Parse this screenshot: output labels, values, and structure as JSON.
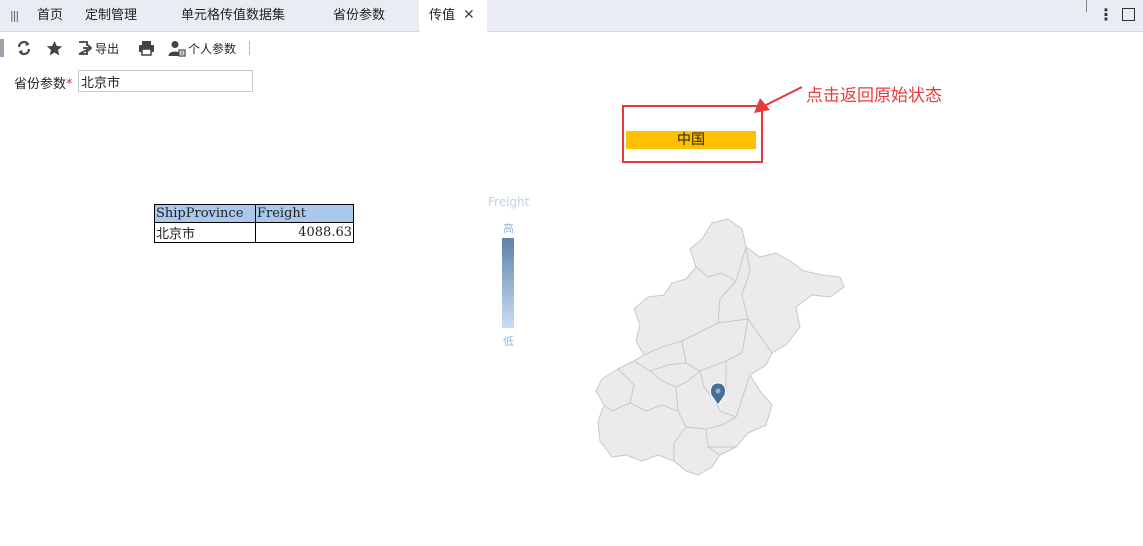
{
  "tabs": [
    {
      "label": "首页"
    },
    {
      "label": "定制管理"
    },
    {
      "label": "单元格传值数据集"
    },
    {
      "label": "省份参数"
    },
    {
      "label": "传值",
      "active": true
    }
  ],
  "toolbar": {
    "export_label": "导出",
    "personal_params_label": "个人参数"
  },
  "param": {
    "label": "省份参数",
    "required_mark": "*",
    "value": "北京市"
  },
  "drill": {
    "button_label": "中国",
    "annotation": "点击返回原始状态"
  },
  "table": {
    "headers": [
      "ShipProvince",
      "Freight"
    ],
    "rows": [
      [
        "北京市",
        "4088.63"
      ]
    ]
  },
  "legend": {
    "title": "Freight",
    "high": "高",
    "low": "低"
  },
  "colors": {
    "accent_yellow": "#ffc000",
    "annotation_red": "#e53b3b",
    "header_blue": "#a8c8ec",
    "marker_blue": "#4a6f96"
  }
}
